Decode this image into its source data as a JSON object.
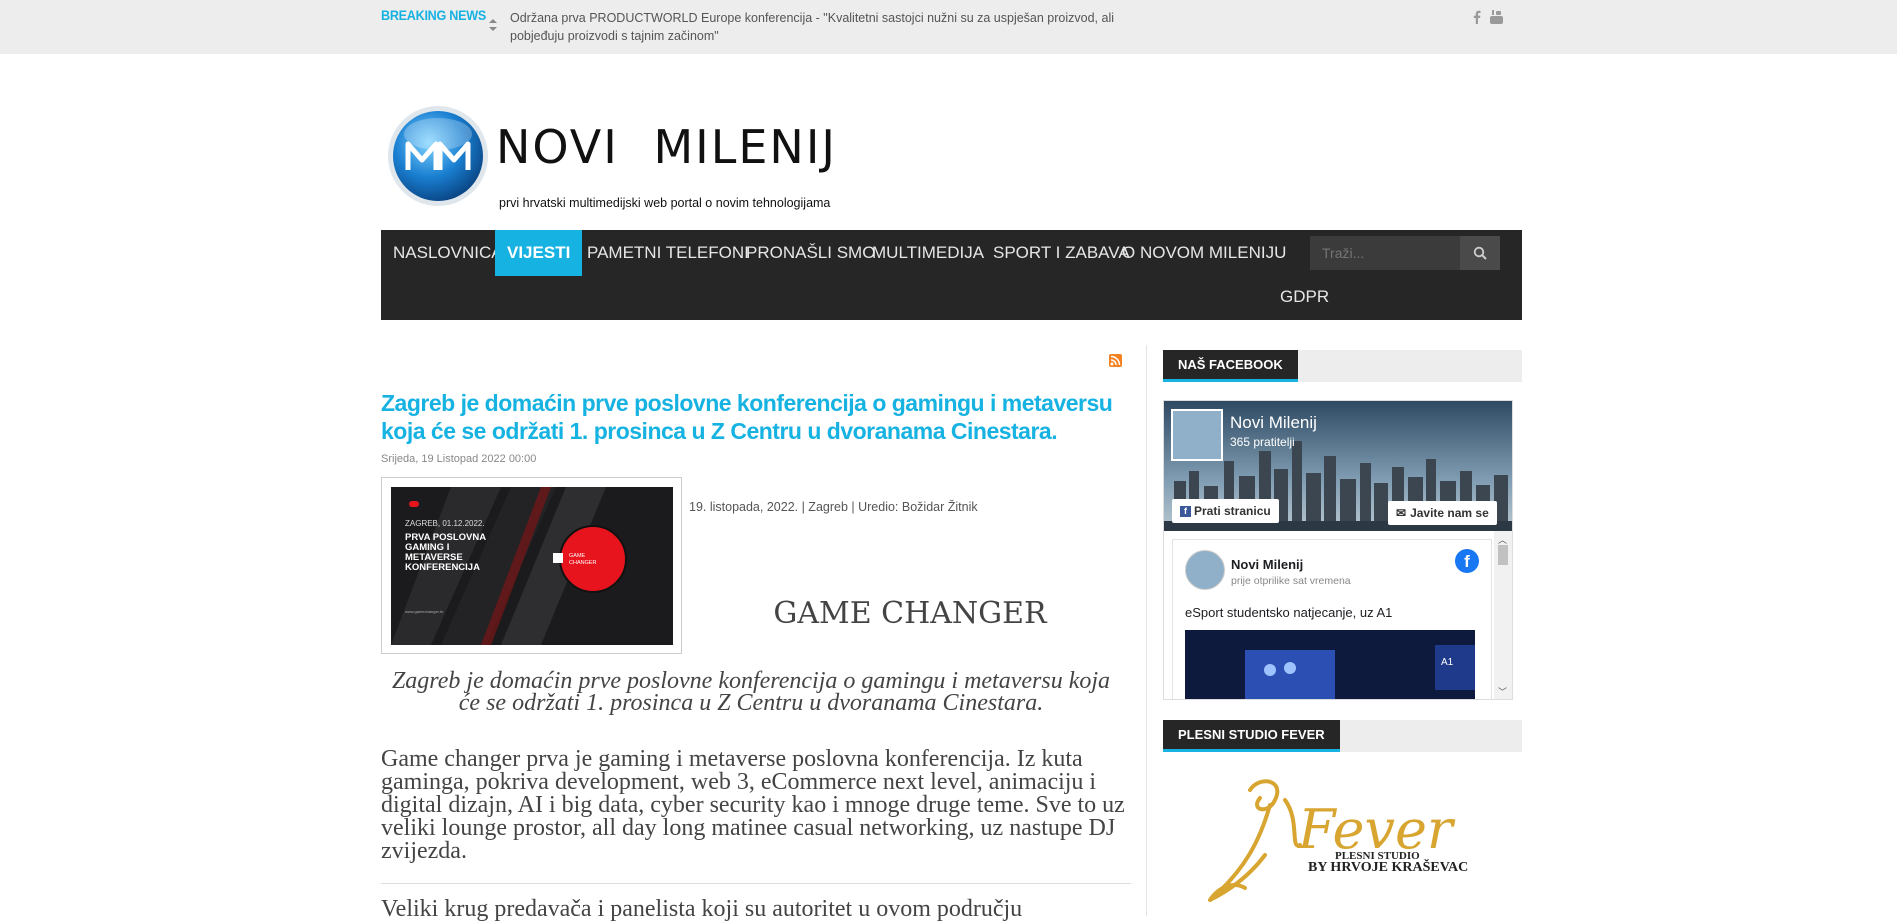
{
  "topbar": {
    "breaking_label": "BREAKING NEWS",
    "ticker_text": "Održana prva PRODUCTWORLD Europe konferencija - \"Kvalitetni sastojci nužni su za uspješan proizvod, ali pobjeđuju proizvodi s tajnim začinom\"",
    "social_icons": [
      "facebook-icon",
      "youtube-icon"
    ]
  },
  "logo": {
    "text": "NOVI  MILENIJ",
    "tagline": "prvi hrvatski multimedijski web portal o novim tehnologijama"
  },
  "nav": {
    "items": [
      {
        "label": "NASLOVNICA",
        "active": false
      },
      {
        "label": "VIJESTI",
        "active": true
      },
      {
        "label": "PAMETNI TELEFONI",
        "active": false
      },
      {
        "label": "PRONAŠLI SMO",
        "active": false
      },
      {
        "label": "MULTIMEDIJA",
        "active": false
      },
      {
        "label": "SPORT I ZABAVA",
        "active": false
      },
      {
        "label": "O NOVOM MILENIJU",
        "active": false
      },
      {
        "label": "GDPR",
        "active": false
      }
    ],
    "search_placeholder": "Traži..."
  },
  "article": {
    "title": "Zagreb je domaćin prve poslovne konferencija o gamingu i metaversu koja će se održati 1. prosinca u Z Centru u dvoranama Cinestara.",
    "date": "Srijeda, 19 Listopad 2022 00:00",
    "thumb": {
      "date": "ZAGREB, 01.12.2022.",
      "headline": "PRVA POSLOVNA GAMING I METAVERSE KONFERENCIJA",
      "url": "www.gamechanger.hr",
      "badge": "GAME CHANGER"
    },
    "meta": "19. listopada, 2022.  |  Zagreb  |  Uredio: Božidar Žitnik",
    "heading": "GAME CHANGER",
    "lead": "Zagreb je domaćin prve poslovne konferencija o gamingu i metaversu koja će se održati 1. prosinca u Z Centru u dvoranama Cinestara.",
    "body1": "Game changer prva je gaming i metaverse poslovna konferencija. Iz kuta gaminga, pokriva development, web 3, eCommerce next level, animaciju i digital dizajn, AI i big data, cyber security kao i mnoge druge teme. Sve to uz veliki lounge prostor, all day long matinee casual networking, uz nastupe DJ zvijezda.",
    "body2": "Veliki krug predavača i panelista koji su autoritet u ovom području"
  },
  "sidebar": {
    "facebook_head": "NAŠ FACEBOOK",
    "fb_page_name": "Novi Milenij",
    "fb_followers": "365 pratitelji",
    "fb_follow": "Prati stranicu",
    "fb_message": "Javite nam se",
    "fb_post_name": "Novi Milenij",
    "fb_post_time": "prije otprilike sat vremena",
    "fb_post_text": "eSport studentsko natjecanje, uz A1",
    "studio_head": "PLESNI STUDIO FEVER",
    "studio_logo_text": "Fever",
    "studio_sub1": "PLESNI STUDIO",
    "studio_sub2": "BY HRVOJE KRAŠEVAC"
  },
  "colors": {
    "accent": "#16b2e2",
    "nav_bg": "#262626",
    "topbar_bg": "#ededed",
    "studio_gold": "#d8a531"
  }
}
